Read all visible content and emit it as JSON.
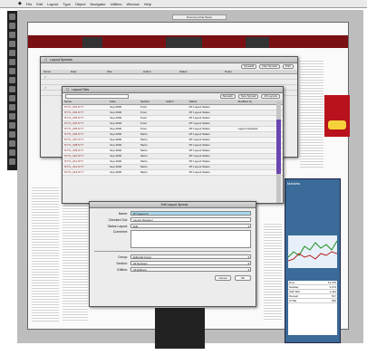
{
  "menubar": {
    "apple": "",
    "items": [
      "File",
      "Edit",
      "Layout",
      "Type",
      "Object",
      "Navigator",
      "Utilities",
      "Window",
      "Help"
    ]
  },
  "document": {
    "title": "Document File Name"
  },
  "layout_window": {
    "title": "Layout Spreads",
    "buttons": [
      "Spreads",
      "New Spread",
      "Print"
    ],
    "headers": [
      "Name",
      "Date",
      "Size",
      "Author",
      "Status",
      "Notes"
    ],
    "rows": [
      {
        "check": "✔",
        "name": "",
        "date": "",
        "size": "",
        "status": ""
      },
      {
        "check": "",
        "name": "",
        "date": "",
        "size": "",
        "status": ""
      },
      {
        "check": "✔",
        "name": "",
        "date": "",
        "size": "",
        "status": ""
      },
      {
        "check": "",
        "name": "",
        "date": "",
        "size": "",
        "status": ""
      }
    ]
  },
  "inner_window": {
    "title": "Layout Files",
    "buttons": [
      "Spreads",
      "New Spread",
      "All Layouts"
    ],
    "headers": [
      "Name",
      "Date",
      "Section",
      "Author",
      "Status",
      "Modified by"
    ],
    "rows": [
      [
        "NYTL_001.NYT",
        "Sep 2000",
        "Front",
        "RT Layout Status",
        ""
      ],
      [
        "NYTL_002.NYT",
        "Sep 2000",
        "Front",
        "RT Layout Status",
        ""
      ],
      [
        "NYTL_003.NYT",
        "Sep 2000",
        "Front",
        "RT Layout Status",
        ""
      ],
      [
        "NYTL_004.NYT",
        "Sep 2000",
        "Front",
        "RT Layout Status",
        ""
      ],
      [
        "NYTL_005.NYT",
        "Sep 2000",
        "Front",
        "RT Layout Status",
        "Layout Checked"
      ],
      [
        "NYTL_006.NYT",
        "Sep 2000",
        "Metro",
        "RT Layout Status",
        ""
      ],
      [
        "NYTL_007.NYT",
        "Sep 2000",
        "Metro",
        "RT Layout Status",
        ""
      ],
      [
        "NYTL_008.NYT",
        "Sep 2000",
        "Metro",
        "RT Layout Status",
        ""
      ],
      [
        "NYTL_009.NYT",
        "Sep 2000",
        "Metro",
        "RT Layout Status",
        ""
      ],
      [
        "NYTL_010.NYT",
        "Sep 2000",
        "Metro",
        "RT Layout Status",
        ""
      ],
      [
        "NYTL_011.NYT",
        "Sep 2000",
        "Metro",
        "RT Layout Status",
        ""
      ],
      [
        "NYTL_012.NYT",
        "Sep 2000",
        "Metro",
        "RT Layout Status",
        ""
      ],
      [
        "NYTL_013.NYT",
        "Sep 2000",
        "Metro",
        "RT Layout Status",
        ""
      ],
      [
        "NYTL_014.NYT",
        "Sep 2000",
        "Metro",
        "RT Layout Status",
        ""
      ],
      [
        "NYTL_015.NYT",
        "Sep 2000",
        "Metro",
        "RT Layout Status",
        ""
      ]
    ]
  },
  "dialog": {
    "title": "Edit Layout Spread",
    "name_label": "Name:",
    "name_value": "RT Layout 9",
    "owner_label": "Checked Out:",
    "owner_value": "Layout Designer",
    "status_label": "Status Layout:",
    "status_value": "Edit",
    "comment_label": "Comment:",
    "group_label": "Group:",
    "group_value": "Editorial Group",
    "section_label": "Section:",
    "section_value": "All Sections",
    "edition_label": "Edition:",
    "edition_value": "All Editions",
    "cancel": "Cancel",
    "ok": "OK"
  },
  "sidebar": {
    "title": "Markets",
    "stocks": [
      [
        "Dow",
        "10,476"
      ],
      [
        "Nasdaq",
        "3,674"
      ],
      [
        "S&P 500",
        "1,434"
      ],
      [
        "Russell",
        "517"
      ],
      [
        "NYSE",
        "660"
      ]
    ]
  },
  "ad": {
    "text": "Mini"
  },
  "colors": {
    "accent_red": "#7a1014",
    "sidebar": "#3a6b99",
    "purple_scroll": "#6b45b0"
  }
}
